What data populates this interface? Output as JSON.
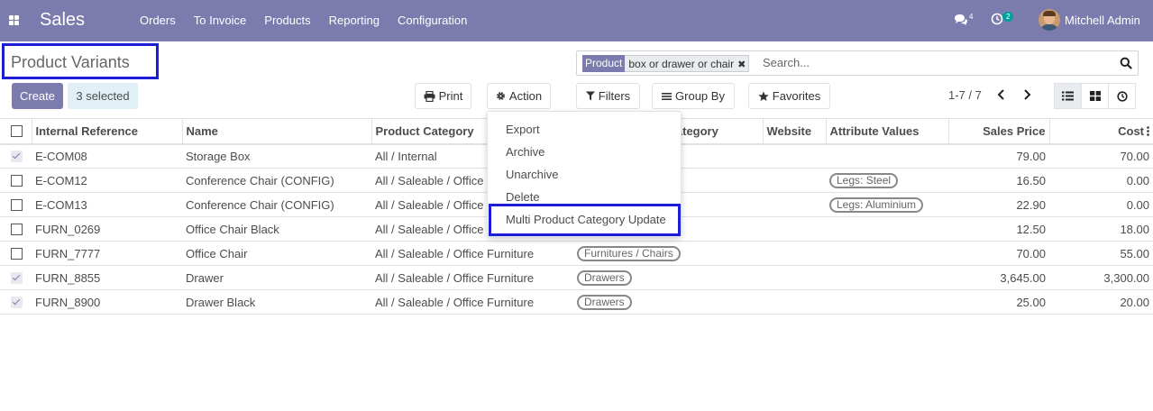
{
  "navbar": {
    "app_name": "Sales",
    "menu": [
      "Orders",
      "To Invoice",
      "Products",
      "Reporting",
      "Configuration"
    ],
    "chat_count": "4",
    "activity_count": "2",
    "user_name": "Mitchell Admin",
    "bg_color": "#7c7bad"
  },
  "control_panel": {
    "title": "Product Variants",
    "create_label": "Create",
    "selected_label": "3 selected",
    "print_label": "Print",
    "action_label": "Action",
    "search": {
      "facet_label": "Product",
      "facet_value": "box or drawer or chair",
      "placeholder": "Search..."
    },
    "filters_label": "Filters",
    "groupby_label": "Group By",
    "favorites_label": "Favorites",
    "pager": "1-7 / 7"
  },
  "action_menu": {
    "items": [
      "Export",
      "Archive",
      "Unarchive",
      "Delete",
      "Multi Product Category Update"
    ]
  },
  "table": {
    "columns": [
      "Internal Reference",
      "Name",
      "Product Category",
      "Category",
      "Website",
      "Attribute Values",
      "Sales Price",
      "Cost"
    ],
    "rows": [
      {
        "selected": true,
        "ref": "E-COM08",
        "name": "Storage Box",
        "category": "All / Internal",
        "pos_category": "",
        "website": "",
        "attributes": "",
        "price": "79.00",
        "cost": "70.00"
      },
      {
        "selected": false,
        "ref": "E-COM12",
        "name": "Conference Chair (CONFIG)",
        "category": "All / Saleable / Office Furniture",
        "pos_category": "",
        "website": "",
        "attributes": "Legs: Steel",
        "price": "16.50",
        "cost": "0.00"
      },
      {
        "selected": false,
        "ref": "E-COM13",
        "name": "Conference Chair (CONFIG)",
        "category": "All / Saleable / Office Furniture",
        "pos_category": "",
        "website": "",
        "attributes": "Legs: Aluminium",
        "price": "22.90",
        "cost": "0.00"
      },
      {
        "selected": false,
        "ref": "FURN_0269",
        "name": "Office Chair Black",
        "category": "All / Saleable / Office Furniture",
        "pos_category": "",
        "website": "",
        "attributes": "",
        "price": "12.50",
        "cost": "18.00"
      },
      {
        "selected": false,
        "ref": "FURN_7777",
        "name": "Office Chair",
        "category": "All / Saleable / Office Furniture",
        "pos_category": "Furnitures / Chairs",
        "website": "",
        "attributes": "",
        "price": "70.00",
        "cost": "55.00"
      },
      {
        "selected": true,
        "ref": "FURN_8855",
        "name": "Drawer",
        "category": "All / Saleable / Office Furniture",
        "pos_category": "Drawers",
        "website": "",
        "attributes": "",
        "price": "3,645.00",
        "cost": "3,300.00"
      },
      {
        "selected": true,
        "ref": "FURN_8900",
        "name": "Drawer Black",
        "category": "All / Saleable / Office Furniture",
        "pos_category": "Drawers",
        "website": "",
        "attributes": "",
        "price": "25.00",
        "cost": "20.00"
      }
    ]
  }
}
